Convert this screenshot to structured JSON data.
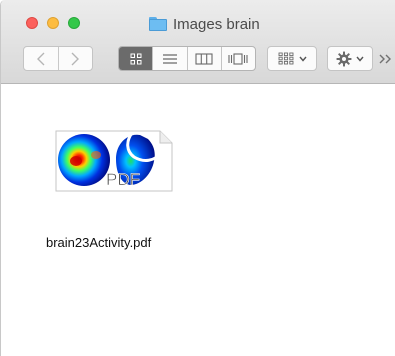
{
  "window": {
    "title": "Images brain"
  },
  "toolbar": {
    "back_icon": "chevron-left-icon",
    "forward_icon": "chevron-right-icon",
    "view_modes": [
      "icon-view",
      "list-view",
      "column-view",
      "cover-flow-view"
    ],
    "active_view": "icon-view",
    "arrange_icon": "arrange-grid-icon",
    "action_icon": "gear-icon",
    "overflow_icon": "double-chevron-right-icon"
  },
  "files": [
    {
      "name": "brain23Activity.pdf",
      "badge": "PDF",
      "icon": "pdf-brain-activity-thumbnail"
    }
  ],
  "colors": {
    "close": "#fc605c",
    "minimize": "#fdbc40",
    "zoom": "#34c84a",
    "folder": "#6dbdf2",
    "active_view_bg": "#6b6b6b"
  }
}
